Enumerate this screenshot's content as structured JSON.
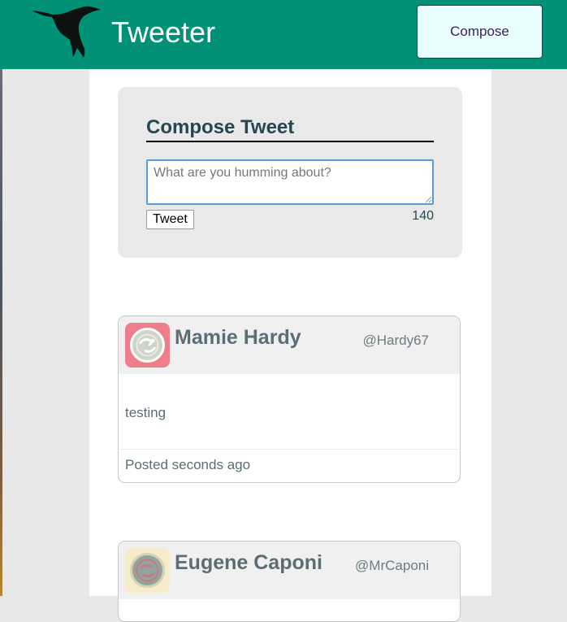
{
  "header": {
    "brand": "Tweeter",
    "compose_button": "Compose",
    "logo_icon": "hummingbird-icon"
  },
  "compose": {
    "title": "Compose Tweet",
    "placeholder": "What are you humming about?",
    "value": "",
    "submit_label": "Tweet",
    "char_counter": "140"
  },
  "tweets": [
    {
      "name": "Mamie Hardy",
      "handle": "@Hardy67",
      "content": "testing",
      "time": "Posted seconds ago",
      "avatar_icon": "avatar-icon",
      "avatar_bg": "#ee7f8a"
    },
    {
      "name": "Eugene Caponi",
      "handle": "@MrCaponi",
      "avatar_icon": "avatar-icon",
      "avatar_bg": "#f6ecc9"
    }
  ],
  "colors": {
    "navbar": "#009177",
    "compose_button_bg": "#e9ffff",
    "page_bg": "#e8e8e8",
    "text_dark": "#244751",
    "input_focus": "#5b9dd9"
  }
}
